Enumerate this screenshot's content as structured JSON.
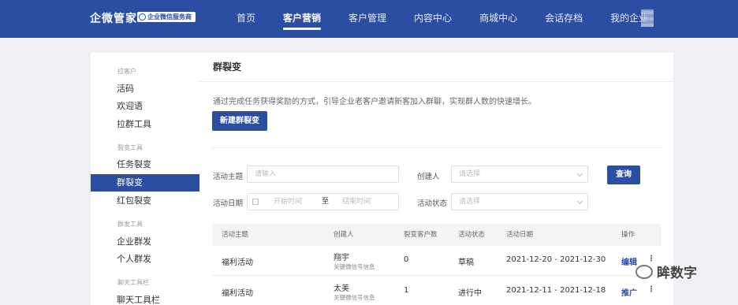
{
  "brand": {
    "name": "企微管家",
    "badge": "企业微信服务商"
  },
  "nav": [
    {
      "label": "首页",
      "active": false
    },
    {
      "label": "客户营销",
      "active": true
    },
    {
      "label": "客户管理",
      "active": false
    },
    {
      "label": "内容中心",
      "active": false
    },
    {
      "label": "商城中心",
      "active": false
    },
    {
      "label": "会话存档",
      "active": false
    },
    {
      "label": "我的企业",
      "active": false
    }
  ],
  "sidebar": {
    "groups": [
      "拉客户",
      "裂变工具",
      "群发工具",
      "聊天工具栏"
    ],
    "items": [
      "活码",
      "欢迎语",
      "拉群工具",
      "任务裂变",
      "群裂变",
      "红包裂变",
      "企业群发",
      "个人群发",
      "聊天工具栏"
    ]
  },
  "main": {
    "title": "群裂变",
    "description": "通过完成任务获得奖励的方式，引导企业老客户邀请新客加入群聊，实现群人数的快速增长。",
    "new_button": "新建群裂变"
  },
  "filters": {
    "topic_label": "活动主题",
    "topic_placeholder": "请输入",
    "creator_label": "创建人",
    "creator_placeholder": "请选择",
    "search_button": "查询",
    "date_label": "活动日期",
    "date_start": "开始时间",
    "date_sep": "至",
    "date_end": "结束时间",
    "status_label": "活动状态",
    "status_placeholder": "请选择"
  },
  "table": {
    "headers": [
      "活动主题",
      "创建人",
      "裂变客户数",
      "活动状态",
      "活动日期",
      "操作"
    ],
    "rows": [
      {
        "topic": "福利活动",
        "creator": "翔宇",
        "creator_sub": "关键微信号信息",
        "count": "0",
        "status": "草稿",
        "date": "2021-12-20 - 2021-12-30",
        "action": "编辑",
        "more": "⋮"
      },
      {
        "topic": "福利活动",
        "creator": "太美",
        "creator_sub": "关键微信号信息",
        "count": "1",
        "status": "进行中",
        "date": "2021-12-11 - 2021-12-18",
        "action": "推广",
        "more": "⋮"
      }
    ]
  },
  "watermark": "眸数字"
}
